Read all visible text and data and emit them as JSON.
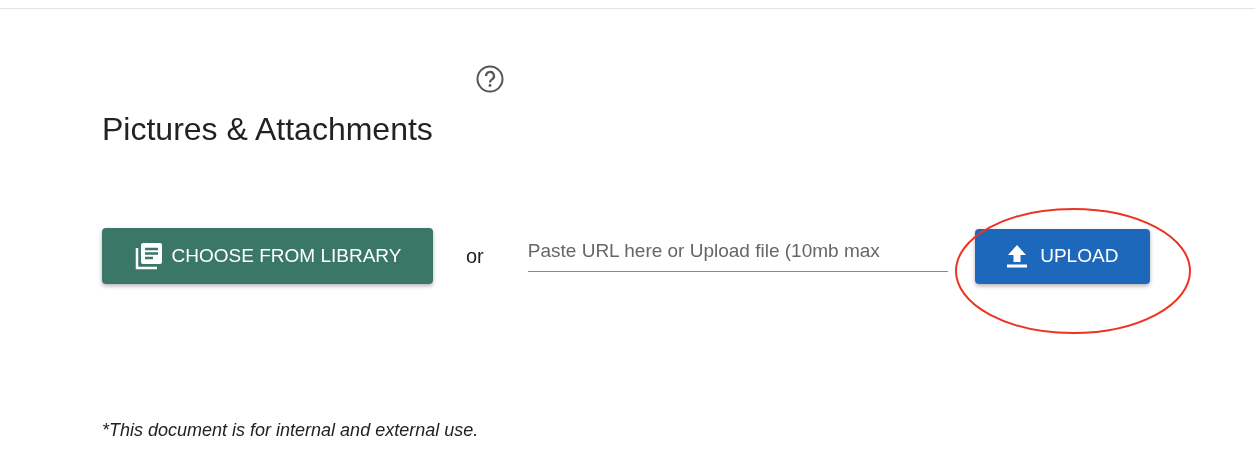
{
  "section": {
    "title": "Pictures & Attachments"
  },
  "actions": {
    "library_button": "CHOOSE FROM LIBRARY",
    "separator": "or",
    "url_field": {
      "placeholder": "Paste URL here or Upload file (10mb max"
    },
    "upload_button": "UPLOAD",
    "upload_highlighted": true
  },
  "footnote": "*This document is for internal and external use."
}
